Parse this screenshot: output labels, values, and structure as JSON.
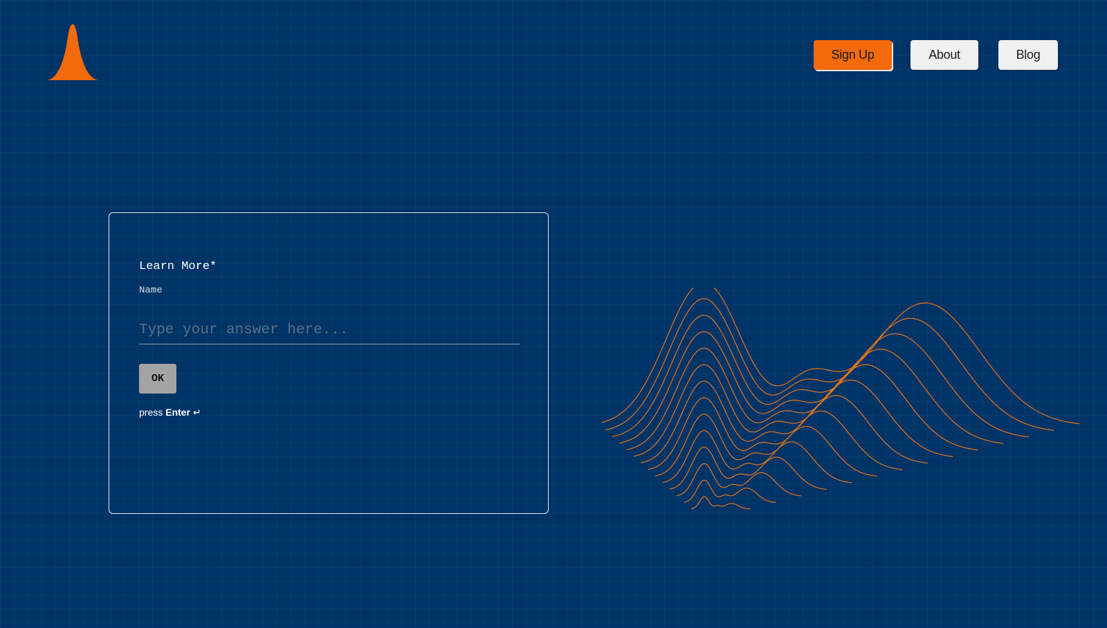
{
  "nav": {
    "signup_label": "Sign Up",
    "about_label": "About",
    "blog_label": "Blog"
  },
  "form": {
    "title": "Learn More*",
    "subtitle": "Name",
    "input_placeholder": "Type your answer here...",
    "input_value": "",
    "ok_label": "OK",
    "hint_prefix": "press",
    "hint_key": "Enter",
    "hint_icon": "↵"
  },
  "colors": {
    "background": "#003366",
    "accent": "#f26a0a",
    "wave_stroke": "#e8761c",
    "button_light": "#f0f0f0",
    "ok_button": "#a3a3a3"
  },
  "icons": {
    "logo": "bell-curve-logo",
    "decoration": "wave-ridges-illustration"
  }
}
